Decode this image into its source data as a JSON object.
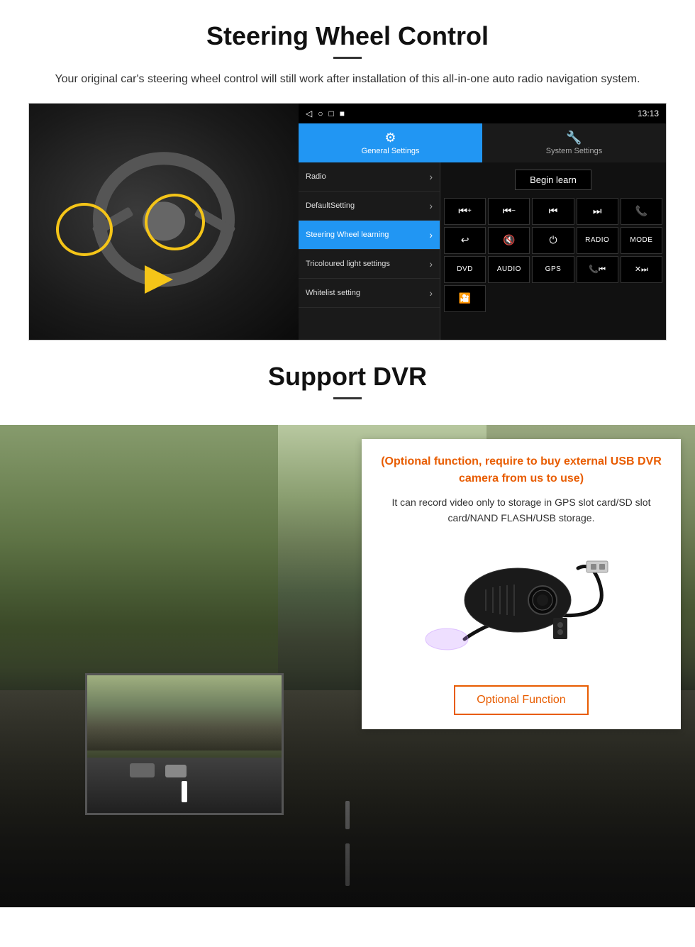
{
  "steering": {
    "title": "Steering Wheel Control",
    "subtitle": "Your original car's steering wheel control will still work after installation of this all-in-one auto radio navigation system.",
    "statusbar": {
      "time": "13:13",
      "icons": [
        "◁",
        "○",
        "□",
        "■"
      ]
    },
    "tabs": {
      "general": {
        "label": "General Settings",
        "icon": "⚙"
      },
      "system": {
        "label": "System Settings",
        "icon": "🔧"
      }
    },
    "menu_items": [
      {
        "label": "Radio",
        "active": false
      },
      {
        "label": "DefaultSetting",
        "active": false
      },
      {
        "label": "Steering Wheel learning",
        "active": true
      },
      {
        "label": "Tricoloured light settings",
        "active": false
      },
      {
        "label": "Whitelist setting",
        "active": false
      }
    ],
    "begin_learn_label": "Begin learn",
    "controls": [
      {
        "symbol": "⏮+",
        "type": "icon"
      },
      {
        "symbol": "⏮−",
        "type": "icon"
      },
      {
        "symbol": "⏮",
        "type": "icon"
      },
      {
        "symbol": "⏭",
        "type": "icon"
      },
      {
        "symbol": "📞",
        "type": "icon"
      },
      {
        "symbol": "↩",
        "type": "icon"
      },
      {
        "symbol": "🔇",
        "type": "icon"
      },
      {
        "symbol": "⏻",
        "type": "icon"
      },
      {
        "symbol": "RADIO",
        "type": "text"
      },
      {
        "symbol": "MODE",
        "type": "text"
      },
      {
        "symbol": "DVD",
        "type": "text"
      },
      {
        "symbol": "AUDIO",
        "type": "text"
      },
      {
        "symbol": "GPS",
        "type": "text"
      },
      {
        "symbol": "📞⏮",
        "type": "icon"
      },
      {
        "symbol": "✕⏭",
        "type": "icon"
      },
      {
        "symbol": "🎦",
        "type": "icon"
      }
    ]
  },
  "dvr": {
    "title": "Support DVR",
    "card": {
      "optional_text": "(Optional function, require to buy external USB DVR camera from us to use)",
      "description": "It can record video only to storage in GPS slot card/SD slot card/NAND FLASH/USB storage.",
      "button_label": "Optional Function"
    }
  }
}
